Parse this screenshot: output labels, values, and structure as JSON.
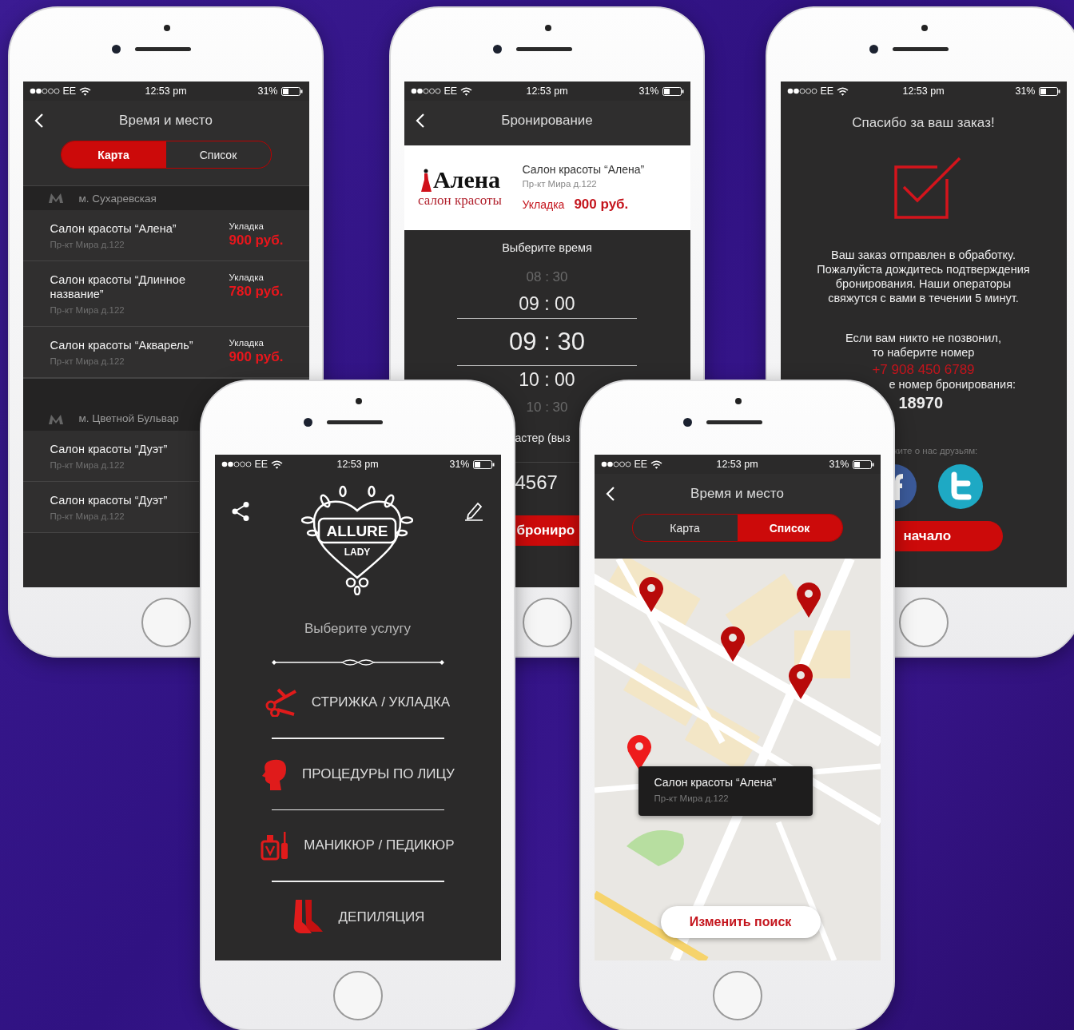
{
  "phones": [
    {
      "kind": "salon_list",
      "status": {
        "carrier": "EE",
        "time": "12:53 pm",
        "battery": "31%"
      },
      "title": "Время и место",
      "tabs": [
        {
          "label": "Карта",
          "selected": true
        },
        {
          "label": "Список",
          "selected": false
        }
      ],
      "groups": [
        {
          "metro": "м. Сухаревская",
          "salons": [
            {
              "name": "Салон красоты “Алена”",
              "address": "Пр-кт Мира д.122",
              "service": "Укладка",
              "price": "900 руб."
            },
            {
              "name": "Салон красоты “Длинное название”",
              "address": "Пр-кт Мира д.122",
              "service": "Укладка",
              "price": "780 руб."
            },
            {
              "name": "Салон красоты “Акварель”",
              "address": "Пр-кт Мира д.122",
              "service": "Укладка",
              "price": "900 руб."
            }
          ]
        },
        {
          "metro": "м. Цветной Бульвар",
          "salons": [
            {
              "name": "Салон красоты “Дуэт”",
              "address": "Пр-кт Мира д.122"
            },
            {
              "name": "Салон красоты “Дуэт”",
              "address": "Пр-кт Мира д.122"
            }
          ]
        }
      ]
    },
    {
      "kind": "booking",
      "status": {
        "carrier": "EE",
        "time": "12:53 pm",
        "battery": "31%"
      },
      "title": "Бронирование",
      "logo": {
        "title": "Алена",
        "subtitle": "салон красоты"
      },
      "salon": {
        "name": "Салон красоты “Алена”",
        "address": "Пр-кт Мира д.122",
        "service": "Укладка",
        "price": "900 руб."
      },
      "picker_label": "Выберите время",
      "times": [
        {
          "time": "08 : 30",
          "selected": false
        },
        {
          "time": "09 : 00",
          "selected": false
        },
        {
          "time": "09 : 30",
          "selected": true
        },
        {
          "time": "10 : 00",
          "selected": false
        },
        {
          "time": "10 : 30",
          "selected": false
        }
      ],
      "field_label": "астер (выз",
      "field_value": "4567",
      "button": "брониро"
    },
    {
      "kind": "confirmation",
      "status": {
        "carrier": "EE",
        "time": "12:53 pm",
        "battery": "31%"
      },
      "title": "Спасибо за ваш заказ!",
      "message": "Ваш заказ отправлен в обработку. Пожалуйста дождитесь подтверждения бронирования. Наши операторы свяжутся с вами в течении 5 минут.",
      "call_hint": "Если вам никто не позвонил, то наберите номер",
      "phone": "+7 908 450 6789",
      "booking_label": "е номер бронирования:",
      "booking_number": "18970",
      "share_label": "ките о нас друзьям:",
      "button": "начало"
    },
    {
      "kind": "services",
      "status": {
        "carrier": "EE",
        "time": "12:53 pm",
        "battery": "31%"
      },
      "logo": {
        "title": "ALLURE",
        "subtitle": "LADY"
      },
      "prompt": "Выберите услугу",
      "services": [
        "СТРИЖКА / УКЛАДКА",
        "ПРОЦЕДУРЫ ПО ЛИЦУ",
        "МАНИКЮР / ПЕДИКЮР",
        "ДЕПИЛЯЦИЯ"
      ]
    },
    {
      "kind": "map",
      "status": {
        "carrier": "EE",
        "time": "12:53 pm",
        "battery": "31%"
      },
      "title": "Время и место",
      "tabs": [
        {
          "label": "Карта",
          "selected": false
        },
        {
          "label": "Список",
          "selected": true
        }
      ],
      "pins": [
        {
          "selected": false
        },
        {
          "selected": false
        },
        {
          "selected": false
        },
        {
          "selected": false
        },
        {
          "selected": true
        }
      ],
      "popup": {
        "name": "Салон красоты “Алена”",
        "address": "Пр-кт Мира д.122"
      },
      "button": "Изменить поиск"
    }
  ]
}
